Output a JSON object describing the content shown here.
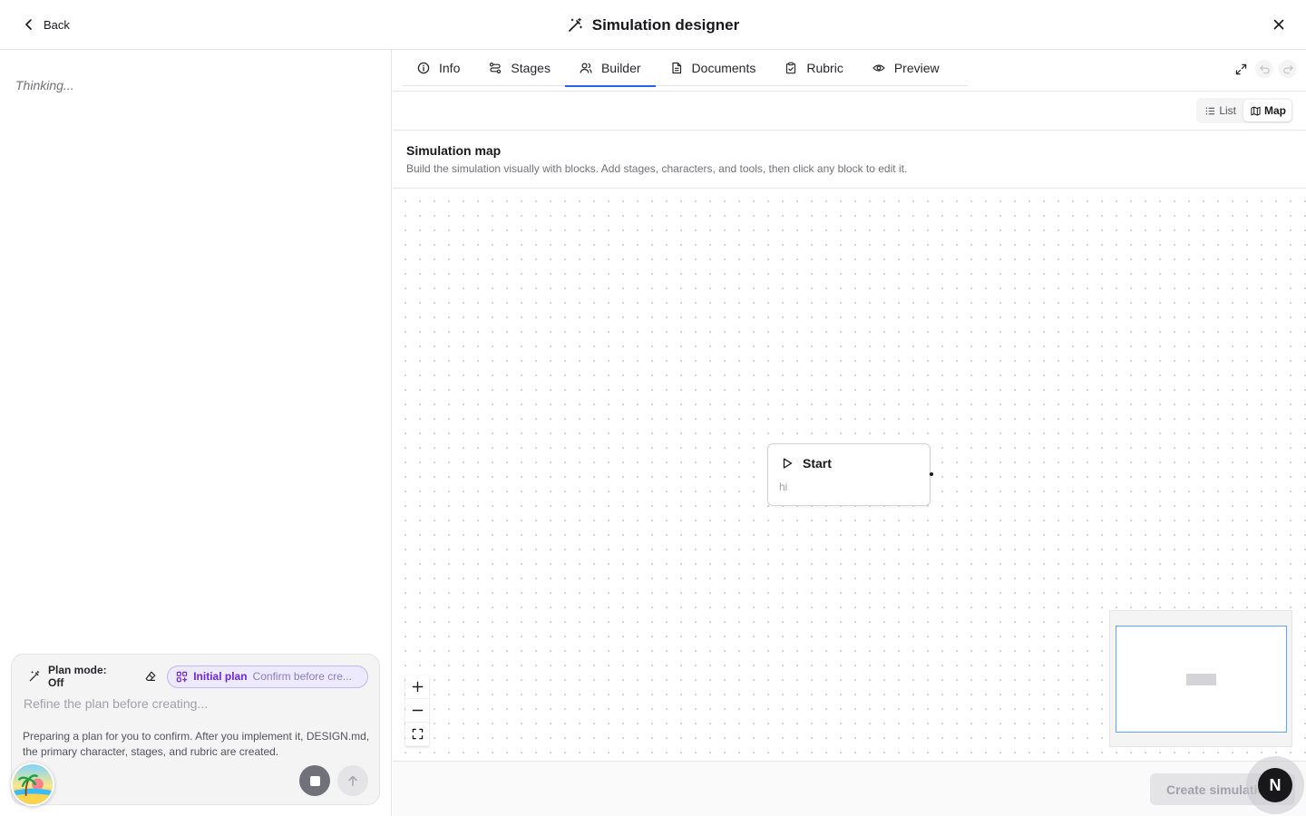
{
  "header": {
    "back_label": "Back",
    "title": "Simulation designer",
    "title_icon": "magic-wand-icon",
    "close_icon": "close-icon"
  },
  "chat": {
    "status_text": "Thinking...",
    "composer": {
      "plan_mode_label": "Plan mode: Off",
      "plan_chip_label": "Initial plan",
      "plan_chip_subtitle": "Confirm before cre...",
      "input_placeholder": "Refine the plan before creating...",
      "input_value": "",
      "note": "Preparing a plan for you to confirm. After you implement it, DESIGN.md, the primary character, stages, and rubric are created."
    }
  },
  "tabs": [
    {
      "label": "Info",
      "icon": "info-icon",
      "active": false
    },
    {
      "label": "Stages",
      "icon": "stages-icon",
      "active": false
    },
    {
      "label": "Builder",
      "icon": "users-icon",
      "active": true
    },
    {
      "label": "Documents",
      "icon": "document-icon",
      "active": false
    },
    {
      "label": "Rubric",
      "icon": "clipboard-icon",
      "active": false
    },
    {
      "label": "Preview",
      "icon": "eye-icon",
      "active": false
    }
  ],
  "view_toggle": {
    "list_label": "List",
    "map_label": "Map",
    "selected": "Map"
  },
  "map": {
    "title": "Simulation map",
    "description": "Build the simulation visually with blocks. Add stages, characters, and tools, then click any block to edit it.",
    "nodes": [
      {
        "title": "Start",
        "subtitle": "hi",
        "icon": "play-icon"
      }
    ]
  },
  "footer": {
    "create_label": "Create simulation"
  },
  "help": {
    "letter": "N"
  },
  "colors": {
    "accent": "#2563eb",
    "plan_chip_bg": "#ede9fe",
    "plan_chip_text": "#6d28d9"
  }
}
